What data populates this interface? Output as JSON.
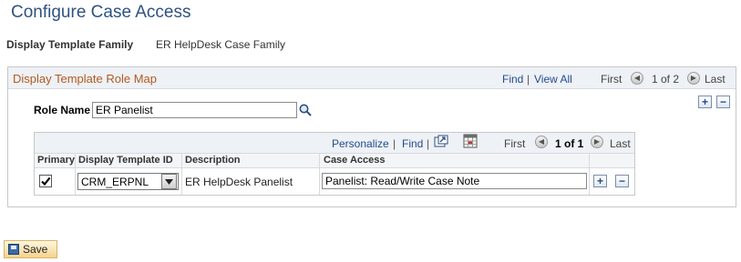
{
  "page": {
    "title": "Configure Case Access"
  },
  "family": {
    "label": "Display Template Family",
    "value": "ER HelpDesk Case Family"
  },
  "role_map": {
    "title": "Display Template Role Map",
    "find": "Find",
    "sep": "|",
    "view_all": "View All",
    "first": "First",
    "count": "1 of 2",
    "last": "Last",
    "add": "+",
    "remove": "−"
  },
  "role": {
    "label": "Role Name",
    "value": "ER Panelist"
  },
  "grid": {
    "personalize": "Personalize",
    "sep": "|",
    "find": "Find",
    "first": "First",
    "count": "1 of 1",
    "last": "Last",
    "columns": {
      "primary": "Primary",
      "template_id": "Display Template ID",
      "description": "Description",
      "case_access": "Case Access"
    },
    "rows": [
      {
        "primary": true,
        "template_id": "CRM_ERPNL",
        "description": "ER HelpDesk Panelist",
        "case_access": "Panelist: Read/Write Case Note"
      }
    ],
    "add": "+",
    "remove": "−"
  },
  "footer": {
    "save": "Save"
  },
  "colors": {
    "title": "#2e5283",
    "section_title": "#b15a22",
    "link": "#1f4c8f"
  }
}
